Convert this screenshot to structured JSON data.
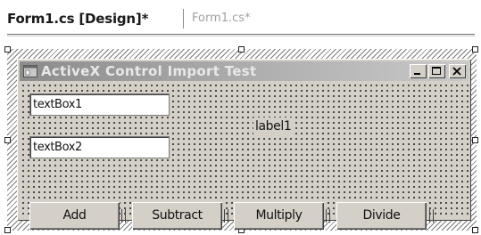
{
  "tabs": {
    "active_label": "Form1.cs [Design]*",
    "inactive_label": "Form1.cs*"
  },
  "form": {
    "title": "ActiveX Control Import Test",
    "caption_buttons": [
      "minimize-icon",
      "maximize-icon",
      "close-icon"
    ],
    "textbox1_value": "textBox1",
    "textbox2_value": "textBox2",
    "label1_text": "label1",
    "buttons": {
      "add": "Add",
      "subtract": "Subtract",
      "multiply": "Multiply",
      "divide": "Divide"
    }
  },
  "colors": {
    "form_face": "#d4d0c8",
    "titlebar_inactive": "#b0b0b0",
    "hatch": "#7a7a7a"
  }
}
